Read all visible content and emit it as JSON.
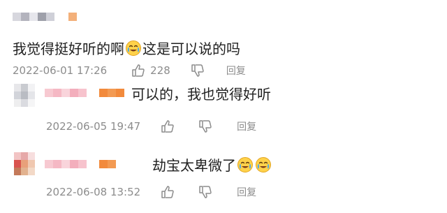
{
  "comments": [
    {
      "text_a": "我觉得挺好听的啊",
      "emoji_1": "laughing-crying-emoji",
      "text_b": "这是可以说的吗",
      "timestamp": "2022-06-01 17:26",
      "like_count": "228",
      "reply_label": "回复"
    },
    {
      "text": "可以的，我也觉得好听",
      "timestamp": "2022-06-05 19:47",
      "reply_label": "回复"
    },
    {
      "text": "劫宝太卑微了",
      "emoji_1": "laughing-crying-emoji",
      "emoji_2": "laughing-crying-emoji",
      "timestamp": "2022-06-08 13:52",
      "reply_label": "回复"
    }
  ],
  "colors": {
    "username_blur_pink": "#f5b8c4",
    "username_blur_orange": "#f28a3c",
    "meta_gray": "#8c8c8c"
  }
}
